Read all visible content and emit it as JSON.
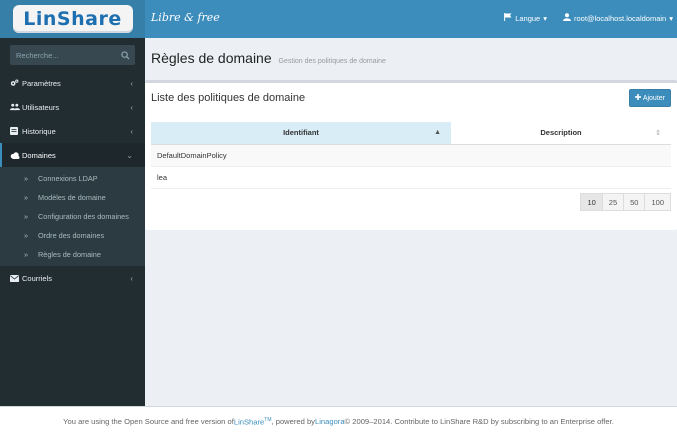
{
  "brand": {
    "logo": "LinShare",
    "slogan": "Libre & free"
  },
  "topbar": {
    "language": "Langue",
    "user": "root@localhost.localdomain"
  },
  "search": {
    "placeholder": "Recherche..."
  },
  "sidebar": {
    "items": [
      {
        "label": "Paramètres"
      },
      {
        "label": "Utilisateurs"
      },
      {
        "label": "Historique"
      },
      {
        "label": "Domaines"
      },
      {
        "label": "Courriels"
      }
    ],
    "domain_sub": [
      {
        "label": "Connexions LDAP"
      },
      {
        "label": "Modèles de domaine"
      },
      {
        "label": "Configuration des domaines"
      },
      {
        "label": "Ordre des domaines"
      },
      {
        "label": "Règles de domaine"
      }
    ]
  },
  "page": {
    "title": "Règles de domaine",
    "subtitle": "Gestion des politiques de domaine"
  },
  "box": {
    "title": "Liste des politiques de domaine",
    "add_label": "Ajouter"
  },
  "table": {
    "headers": [
      "Identifiant",
      "Description"
    ],
    "rows": [
      [
        "DefaultDomainPolicy",
        ""
      ],
      [
        "lea",
        ""
      ]
    ]
  },
  "pagination": [
    "10",
    "25",
    "50",
    "100"
  ],
  "footer": {
    "prefix": "You are using the Open Source and free version of ",
    "linshare": "LinShare",
    "tm": "TM",
    "middle": ", powered by ",
    "linagora": "Linagora",
    "suffix": " © 2009–2014. Contribute to LinShare R&D by subscribing to an Enterprise offer."
  },
  "colors": {
    "accent": "#3c8dbc",
    "sidebar": "#222d32",
    "sorted_header": "#d9edf7"
  }
}
